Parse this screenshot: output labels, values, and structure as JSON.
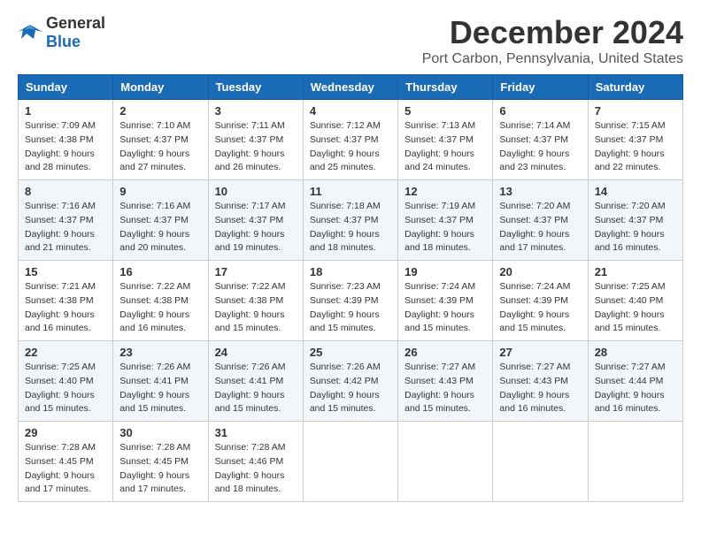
{
  "header": {
    "logo_general": "General",
    "logo_blue": "Blue",
    "title": "December 2024",
    "subtitle": "Port Carbon, Pennsylvania, United States"
  },
  "calendar": {
    "days_of_week": [
      "Sunday",
      "Monday",
      "Tuesday",
      "Wednesday",
      "Thursday",
      "Friday",
      "Saturday"
    ],
    "weeks": [
      [
        {
          "day": "1",
          "sunrise": "7:09 AM",
          "sunset": "4:38 PM",
          "daylight": "9 hours and 28 minutes."
        },
        {
          "day": "2",
          "sunrise": "7:10 AM",
          "sunset": "4:37 PM",
          "daylight": "9 hours and 27 minutes."
        },
        {
          "day": "3",
          "sunrise": "7:11 AM",
          "sunset": "4:37 PM",
          "daylight": "9 hours and 26 minutes."
        },
        {
          "day": "4",
          "sunrise": "7:12 AM",
          "sunset": "4:37 PM",
          "daylight": "9 hours and 25 minutes."
        },
        {
          "day": "5",
          "sunrise": "7:13 AM",
          "sunset": "4:37 PM",
          "daylight": "9 hours and 24 minutes."
        },
        {
          "day": "6",
          "sunrise": "7:14 AM",
          "sunset": "4:37 PM",
          "daylight": "9 hours and 23 minutes."
        },
        {
          "day": "7",
          "sunrise": "7:15 AM",
          "sunset": "4:37 PM",
          "daylight": "9 hours and 22 minutes."
        }
      ],
      [
        {
          "day": "8",
          "sunrise": "7:16 AM",
          "sunset": "4:37 PM",
          "daylight": "9 hours and 21 minutes."
        },
        {
          "day": "9",
          "sunrise": "7:16 AM",
          "sunset": "4:37 PM",
          "daylight": "9 hours and 20 minutes."
        },
        {
          "day": "10",
          "sunrise": "7:17 AM",
          "sunset": "4:37 PM",
          "daylight": "9 hours and 19 minutes."
        },
        {
          "day": "11",
          "sunrise": "7:18 AM",
          "sunset": "4:37 PM",
          "daylight": "9 hours and 18 minutes."
        },
        {
          "day": "12",
          "sunrise": "7:19 AM",
          "sunset": "4:37 PM",
          "daylight": "9 hours and 18 minutes."
        },
        {
          "day": "13",
          "sunrise": "7:20 AM",
          "sunset": "4:37 PM",
          "daylight": "9 hours and 17 minutes."
        },
        {
          "day": "14",
          "sunrise": "7:20 AM",
          "sunset": "4:37 PM",
          "daylight": "9 hours and 16 minutes."
        }
      ],
      [
        {
          "day": "15",
          "sunrise": "7:21 AM",
          "sunset": "4:38 PM",
          "daylight": "9 hours and 16 minutes."
        },
        {
          "day": "16",
          "sunrise": "7:22 AM",
          "sunset": "4:38 PM",
          "daylight": "9 hours and 16 minutes."
        },
        {
          "day": "17",
          "sunrise": "7:22 AM",
          "sunset": "4:38 PM",
          "daylight": "9 hours and 15 minutes."
        },
        {
          "day": "18",
          "sunrise": "7:23 AM",
          "sunset": "4:39 PM",
          "daylight": "9 hours and 15 minutes."
        },
        {
          "day": "19",
          "sunrise": "7:24 AM",
          "sunset": "4:39 PM",
          "daylight": "9 hours and 15 minutes."
        },
        {
          "day": "20",
          "sunrise": "7:24 AM",
          "sunset": "4:39 PM",
          "daylight": "9 hours and 15 minutes."
        },
        {
          "day": "21",
          "sunrise": "7:25 AM",
          "sunset": "4:40 PM",
          "daylight": "9 hours and 15 minutes."
        }
      ],
      [
        {
          "day": "22",
          "sunrise": "7:25 AM",
          "sunset": "4:40 PM",
          "daylight": "9 hours and 15 minutes."
        },
        {
          "day": "23",
          "sunrise": "7:26 AM",
          "sunset": "4:41 PM",
          "daylight": "9 hours and 15 minutes."
        },
        {
          "day": "24",
          "sunrise": "7:26 AM",
          "sunset": "4:41 PM",
          "daylight": "9 hours and 15 minutes."
        },
        {
          "day": "25",
          "sunrise": "7:26 AM",
          "sunset": "4:42 PM",
          "daylight": "9 hours and 15 minutes."
        },
        {
          "day": "26",
          "sunrise": "7:27 AM",
          "sunset": "4:43 PM",
          "daylight": "9 hours and 15 minutes."
        },
        {
          "day": "27",
          "sunrise": "7:27 AM",
          "sunset": "4:43 PM",
          "daylight": "9 hours and 16 minutes."
        },
        {
          "day": "28",
          "sunrise": "7:27 AM",
          "sunset": "4:44 PM",
          "daylight": "9 hours and 16 minutes."
        }
      ],
      [
        {
          "day": "29",
          "sunrise": "7:28 AM",
          "sunset": "4:45 PM",
          "daylight": "9 hours and 17 minutes."
        },
        {
          "day": "30",
          "sunrise": "7:28 AM",
          "sunset": "4:45 PM",
          "daylight": "9 hours and 17 minutes."
        },
        {
          "day": "31",
          "sunrise": "7:28 AM",
          "sunset": "4:46 PM",
          "daylight": "9 hours and 18 minutes."
        },
        null,
        null,
        null,
        null
      ]
    ],
    "labels": {
      "sunrise": "Sunrise:",
      "sunset": "Sunset:",
      "daylight": "Daylight:"
    }
  }
}
